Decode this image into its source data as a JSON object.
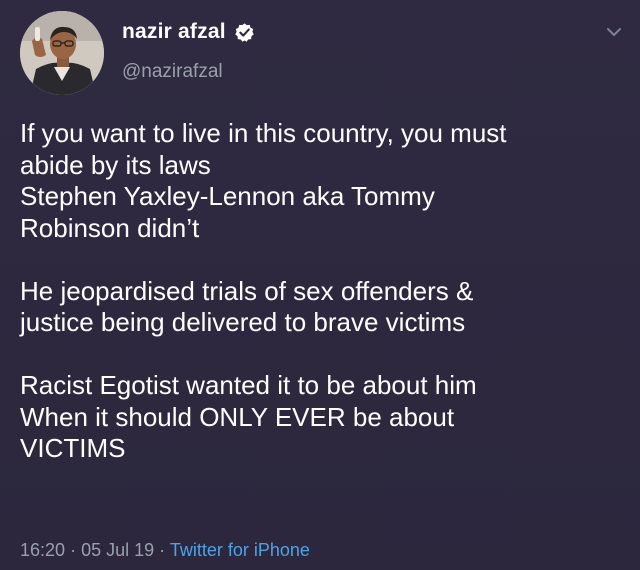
{
  "author": {
    "display_name": "nazir afzal",
    "handle": "@nazirafzal",
    "verified": true
  },
  "icons": {
    "verified": "verified-badge-icon",
    "more": "chevron-down-icon"
  },
  "tweet": {
    "paragraphs": [
      [
        "If you want to live in this country, you must",
        "abide by its laws",
        "Stephen Yaxley-Lennon aka Tommy",
        "Robinson didn’t"
      ],
      [
        "He jeopardised trials of sex offenders &",
        "justice being delivered to brave victims"
      ],
      [
        "Racist Egotist wanted it to be about him",
        "When it should ONLY EVER be about",
        "VICTIMS"
      ]
    ]
  },
  "meta": {
    "time": "16:20",
    "separator": "·",
    "date": "05 Jul 19",
    "source": "Twitter for iPhone"
  },
  "colors": {
    "background": "#2f2940",
    "secondary_text": "#9aa0aa",
    "link": "#4aa3e8"
  }
}
